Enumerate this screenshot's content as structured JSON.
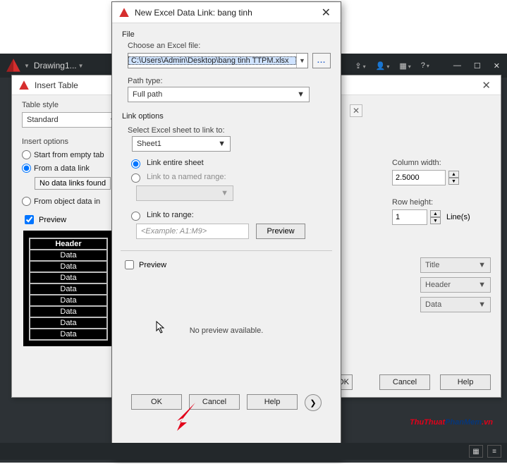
{
  "app": {
    "doc_title": "Drawing1...",
    "menu_icons": [
      "share-icon",
      "user-icon",
      "apps-icon",
      "help-icon"
    ]
  },
  "insert_table": {
    "title": "Insert Table",
    "table_style_label": "Table style",
    "table_style_value": "Standard",
    "insert_options_label": "Insert options",
    "opt_empty": "Start from empty tab",
    "opt_datalink": "From a data link",
    "no_links": "No data links found",
    "opt_object": "From object data in ",
    "preview_label": "Preview",
    "header": "Header",
    "data": "Data",
    "col_width_label": "Column width:",
    "col_width_value": "2.5000",
    "row_height_label": "Row height:",
    "row_height_value": "1",
    "row_height_unit": "Line(s)",
    "style_title": "Title",
    "style_header": "Header",
    "style_data": "Data",
    "ok_stub": "OK",
    "cancel": "Cancel",
    "help": "Help"
  },
  "data_link": {
    "title": "New Excel Data Link: bang tinh",
    "file_group": "File",
    "choose_label": "Choose an Excel file:",
    "file_value": "C:\\Users\\Admin\\Desktop\\bang tinh TTPM.xlsx",
    "path_type_label": "Path type:",
    "path_type_value": "Full path",
    "link_options": "Link options",
    "select_sheet_label": "Select Excel sheet to link to:",
    "sheet_value": "Sheet1",
    "opt_entire": "Link entire sheet",
    "opt_named": "Link to a named range:",
    "opt_range": "Link to range:",
    "range_placeholder": "<Example: A1:M9>",
    "preview_btn": "Preview",
    "preview_chk": "Preview",
    "no_preview": "No preview available.",
    "ok": "OK",
    "cancel": "Cancel",
    "help": "Help"
  },
  "watermark": {
    "a": "ThuThuat",
    "b": "PhanMem",
    "c": ".vn"
  }
}
